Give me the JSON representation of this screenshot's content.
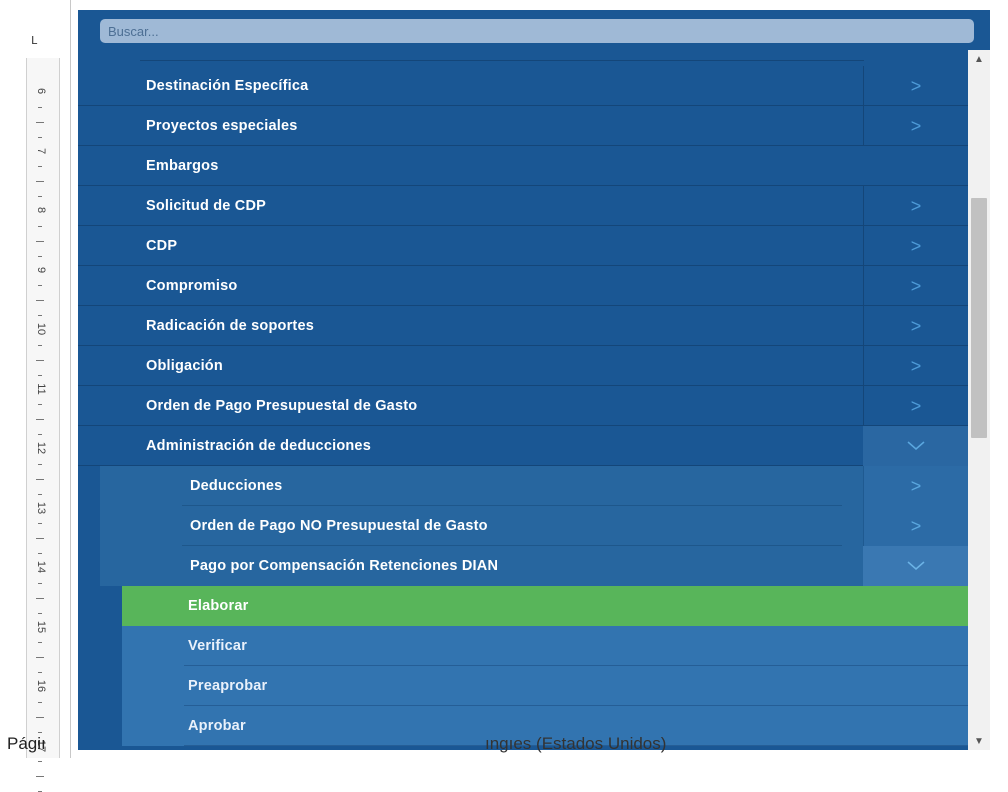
{
  "ruler": {
    "corner": "L",
    "numbers": [
      "6",
      "7",
      "8",
      "9",
      "10",
      "11",
      "12",
      "13",
      "14",
      "15",
      "16",
      "17"
    ]
  },
  "status_bar": {
    "text": "Págiı",
    "text_right": "ıngıes (Estados Unidos)"
  },
  "search": {
    "placeholder": "Buscar..."
  },
  "menu": {
    "items": [
      {
        "label": "Destinación Específica",
        "arrow": ">"
      },
      {
        "label": "Proyectos especiales",
        "arrow": ">"
      },
      {
        "label": "Embargos",
        "arrow": ""
      },
      {
        "label": "Solicitud de CDP",
        "arrow": ">"
      },
      {
        "label": "CDP",
        "arrow": ">"
      },
      {
        "label": "Compromiso",
        "arrow": ">"
      },
      {
        "label": "Radicación de soportes",
        "arrow": ">"
      },
      {
        "label": "Obligación",
        "arrow": ">"
      },
      {
        "label": "Orden de Pago Presupuestal de Gasto",
        "arrow": ">"
      },
      {
        "label": "Administración de deducciones",
        "arrow": "expanded"
      }
    ],
    "submenu": [
      {
        "label": "Deducciones",
        "arrow": ">"
      },
      {
        "label": "Orden de Pago NO Presupuestal de Gasto",
        "arrow": ">"
      },
      {
        "label": "Pago por Compensación Retenciones DIAN",
        "arrow": "expanded"
      }
    ],
    "subsubmenu": [
      {
        "label": "Elaborar",
        "active": true
      },
      {
        "label": "Verificar",
        "active": false
      },
      {
        "label": "Preaprobar",
        "active": false
      },
      {
        "label": "Aprobar",
        "active": false
      }
    ]
  },
  "colors": {
    "panel_bg": "#1a5794",
    "active_item": "#58b55a",
    "arrow": "#4d9bd8"
  }
}
